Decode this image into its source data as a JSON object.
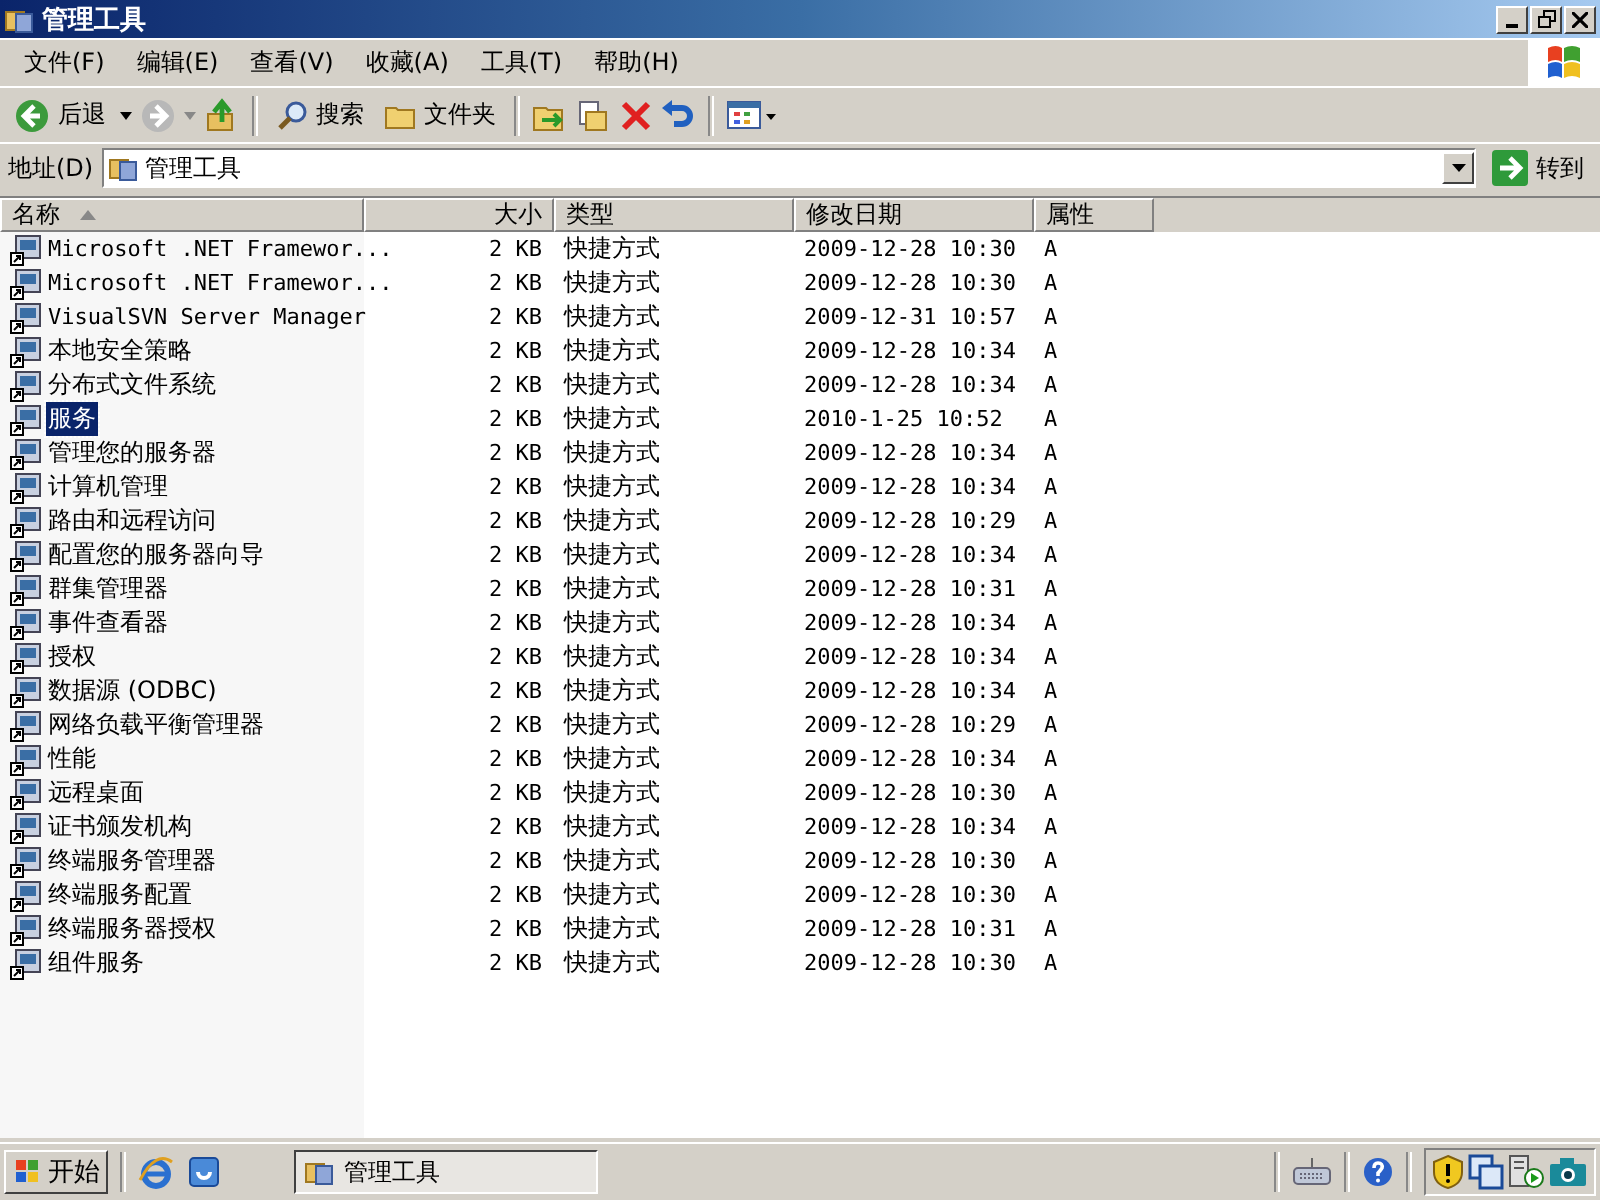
{
  "window": {
    "title": "管理工具"
  },
  "menu": [
    "文件(F)",
    "编辑(E)",
    "查看(V)",
    "收藏(A)",
    "工具(T)",
    "帮助(H)"
  ],
  "toolbar": {
    "back": "后退",
    "search": "搜索",
    "folders": "文件夹"
  },
  "address": {
    "label": "地址(D)",
    "value": "管理工具",
    "go": "转到"
  },
  "columns": [
    {
      "label": "名称",
      "sorted": true
    },
    {
      "label": "大小",
      "sorted": false
    },
    {
      "label": "类型",
      "sorted": false
    },
    {
      "label": "修改日期",
      "sorted": false
    },
    {
      "label": "属性",
      "sorted": false
    }
  ],
  "rows": [
    {
      "name": "Microsoft .NET Framewor...",
      "size": "2 KB",
      "type": "快捷方式",
      "modified": "2009-12-28 10:30",
      "attr": "A",
      "selected": false
    },
    {
      "name": "Microsoft .NET Framewor...",
      "size": "2 KB",
      "type": "快捷方式",
      "modified": "2009-12-28 10:30",
      "attr": "A",
      "selected": false
    },
    {
      "name": "VisualSVN Server Manager",
      "size": "2 KB",
      "type": "快捷方式",
      "modified": "2009-12-31 10:57",
      "attr": "A",
      "selected": false
    },
    {
      "name": "本地安全策略",
      "size": "2 KB",
      "type": "快捷方式",
      "modified": "2009-12-28 10:34",
      "attr": "A",
      "selected": false
    },
    {
      "name": "分布式文件系统",
      "size": "2 KB",
      "type": "快捷方式",
      "modified": "2009-12-28 10:34",
      "attr": "A",
      "selected": false
    },
    {
      "name": "服务",
      "size": "2 KB",
      "type": "快捷方式",
      "modified": "2010-1-25 10:52",
      "attr": "A",
      "selected": true
    },
    {
      "name": "管理您的服务器",
      "size": "2 KB",
      "type": "快捷方式",
      "modified": "2009-12-28 10:34",
      "attr": "A",
      "selected": false
    },
    {
      "name": "计算机管理",
      "size": "2 KB",
      "type": "快捷方式",
      "modified": "2009-12-28 10:34",
      "attr": "A",
      "selected": false
    },
    {
      "name": "路由和远程访问",
      "size": "2 KB",
      "type": "快捷方式",
      "modified": "2009-12-28 10:29",
      "attr": "A",
      "selected": false
    },
    {
      "name": "配置您的服务器向导",
      "size": "2 KB",
      "type": "快捷方式",
      "modified": "2009-12-28 10:34",
      "attr": "A",
      "selected": false
    },
    {
      "name": "群集管理器",
      "size": "2 KB",
      "type": "快捷方式",
      "modified": "2009-12-28 10:31",
      "attr": "A",
      "selected": false
    },
    {
      "name": "事件查看器",
      "size": "2 KB",
      "type": "快捷方式",
      "modified": "2009-12-28 10:34",
      "attr": "A",
      "selected": false
    },
    {
      "name": "授权",
      "size": "2 KB",
      "type": "快捷方式",
      "modified": "2009-12-28 10:34",
      "attr": "A",
      "selected": false
    },
    {
      "name": "数据源 (ODBC)",
      "size": "2 KB",
      "type": "快捷方式",
      "modified": "2009-12-28 10:34",
      "attr": "A",
      "selected": false
    },
    {
      "name": "网络负载平衡管理器",
      "size": "2 KB",
      "type": "快捷方式",
      "modified": "2009-12-28 10:29",
      "attr": "A",
      "selected": false
    },
    {
      "name": "性能",
      "size": "2 KB",
      "type": "快捷方式",
      "modified": "2009-12-28 10:34",
      "attr": "A",
      "selected": false
    },
    {
      "name": "远程桌面",
      "size": "2 KB",
      "type": "快捷方式",
      "modified": "2009-12-28 10:30",
      "attr": "A",
      "selected": false
    },
    {
      "name": "证书颁发机构",
      "size": "2 KB",
      "type": "快捷方式",
      "modified": "2009-12-28 10:34",
      "attr": "A",
      "selected": false
    },
    {
      "name": "终端服务管理器",
      "size": "2 KB",
      "type": "快捷方式",
      "modified": "2009-12-28 10:30",
      "attr": "A",
      "selected": false
    },
    {
      "name": "终端服务配置",
      "size": "2 KB",
      "type": "快捷方式",
      "modified": "2009-12-28 10:30",
      "attr": "A",
      "selected": false
    },
    {
      "name": "终端服务器授权",
      "size": "2 KB",
      "type": "快捷方式",
      "modified": "2009-12-28 10:31",
      "attr": "A",
      "selected": false
    },
    {
      "name": "组件服务",
      "size": "2 KB",
      "type": "快捷方式",
      "modified": "2009-12-28 10:30",
      "attr": "A",
      "selected": false
    }
  ],
  "taskbar": {
    "start": "开始",
    "task": "管理工具"
  }
}
